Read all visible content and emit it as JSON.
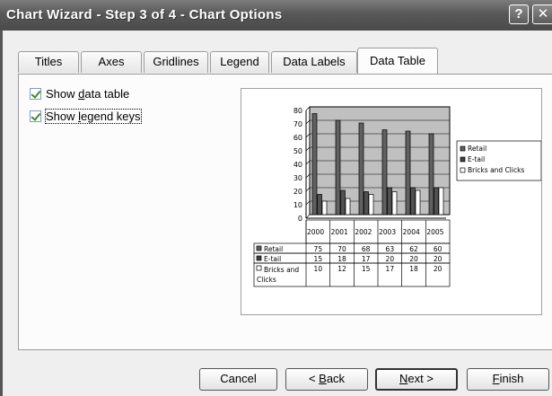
{
  "window": {
    "title": "Chart Wizard - Step 3 of 4 - Chart Options",
    "help_glyph": "?",
    "close_glyph": "✕"
  },
  "tabs": [
    {
      "label": "Titles",
      "active": false
    },
    {
      "label": "Axes",
      "active": false
    },
    {
      "label": "Gridlines",
      "active": false
    },
    {
      "label": "Legend",
      "active": false
    },
    {
      "label": "Data Labels",
      "active": false
    },
    {
      "label": "Data Table",
      "active": true
    }
  ],
  "options": {
    "show_data_table": {
      "label_pre": "Show ",
      "label_key": "d",
      "label_post": "ata table",
      "checked": true
    },
    "show_legend_keys": {
      "label_pre": "Show ",
      "label_key": "l",
      "label_post": "egend keys",
      "checked": true
    }
  },
  "chart_data": {
    "type": "bar",
    "categories": [
      "2000",
      "2001",
      "2002",
      "2003",
      "2004",
      "2005"
    ],
    "series": [
      {
        "name": "Retail",
        "values": [
          75,
          70,
          68,
          63,
          62,
          60
        ],
        "color": "#606060"
      },
      {
        "name": "E-tail",
        "values": [
          15,
          18,
          17,
          20,
          20,
          20
        ],
        "color": "#505050"
      },
      {
        "name": "Bricks and Clicks",
        "values": [
          10,
          12,
          15,
          17,
          18,
          20
        ],
        "color": "#ffffff"
      }
    ],
    "ylim": [
      0,
      80
    ],
    "yticks": [
      "0",
      "10",
      "20",
      "30",
      "40",
      "50",
      "60",
      "70",
      "80"
    ],
    "plot_area_color": "#c0c0c0",
    "table_row_labels": [
      "Retail",
      "E-tail",
      "Bricks and",
      "Clicks"
    ],
    "legend": {
      "position": "right",
      "entries": [
        "Retail",
        "E-tail",
        "Bricks and Clicks"
      ]
    }
  },
  "buttons": {
    "cancel": "Cancel",
    "back_pre": "< ",
    "back_key": "B",
    "back_post": "ack",
    "next_key": "N",
    "next_post": "ext >",
    "finish_key": "F",
    "finish_post": "inish"
  }
}
